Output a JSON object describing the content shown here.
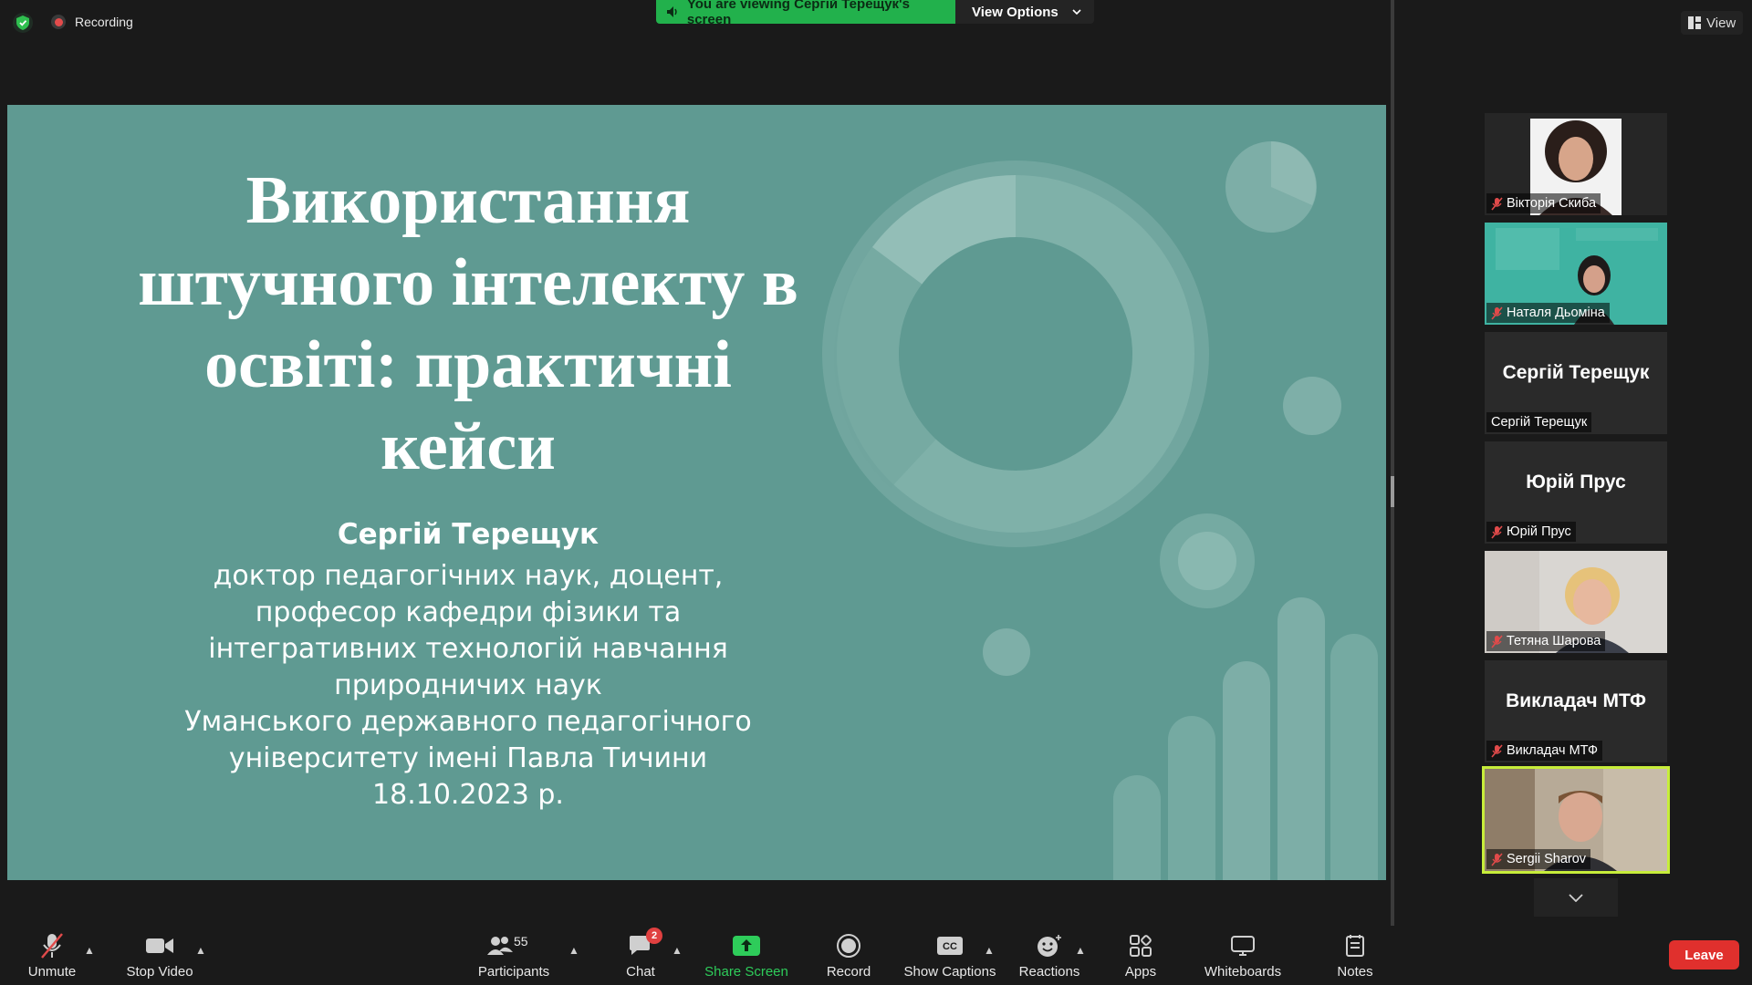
{
  "top": {
    "recording_label": "Recording",
    "viewing_banner": "You are viewing Сергій Терещук's screen",
    "view_options_label": "View Options",
    "view_label": "View"
  },
  "slide": {
    "title_lines": [
      "Використання",
      "штучного інтелекту в",
      "освіті: практичні",
      "кейси"
    ],
    "author": "Сергій Терещук",
    "desc_lines": [
      "доктор педагогічних наук, доцент,",
      "професор кафедри фізики та",
      "інтегративних технологій навчання",
      "природничих наук",
      "Уманського державного педагогічного",
      "університету імені Павла Тичини",
      "18.10.2023 р."
    ]
  },
  "participants": [
    {
      "name": "Вікторія Скиба",
      "muted": true,
      "kind": "photo"
    },
    {
      "name": "Наталя Дьоміна",
      "muted": true,
      "kind": "photo"
    },
    {
      "name": "Сергій Терещук",
      "muted": false,
      "kind": "name",
      "big": "Сергій Терещук"
    },
    {
      "name": "Юрій Прус",
      "muted": true,
      "kind": "name",
      "big": "Юрій Прус"
    },
    {
      "name": "Тетяна Шарова",
      "muted": true,
      "kind": "photo"
    },
    {
      "name": "Викладач МТФ",
      "muted": true,
      "kind": "name",
      "big": "Викладач МТФ"
    },
    {
      "name": "Sergii Sharov",
      "muted": true,
      "kind": "photo",
      "active": true
    }
  ],
  "toolbar": {
    "unmute": "Unmute",
    "stop_video": "Stop Video",
    "participants": "Participants",
    "participants_count": "55",
    "chat": "Chat",
    "chat_badge": "2",
    "share_screen": "Share Screen",
    "record": "Record",
    "show_captions": "Show Captions",
    "reactions": "Reactions",
    "apps": "Apps",
    "whiteboards": "Whiteboards",
    "notes": "Notes",
    "leave": "Leave"
  },
  "colors": {
    "slide_bg": "#5f9a92",
    "banner_green": "#22b14c",
    "leave_red": "#e0302d",
    "active_speaker": "#c7ed3a"
  }
}
